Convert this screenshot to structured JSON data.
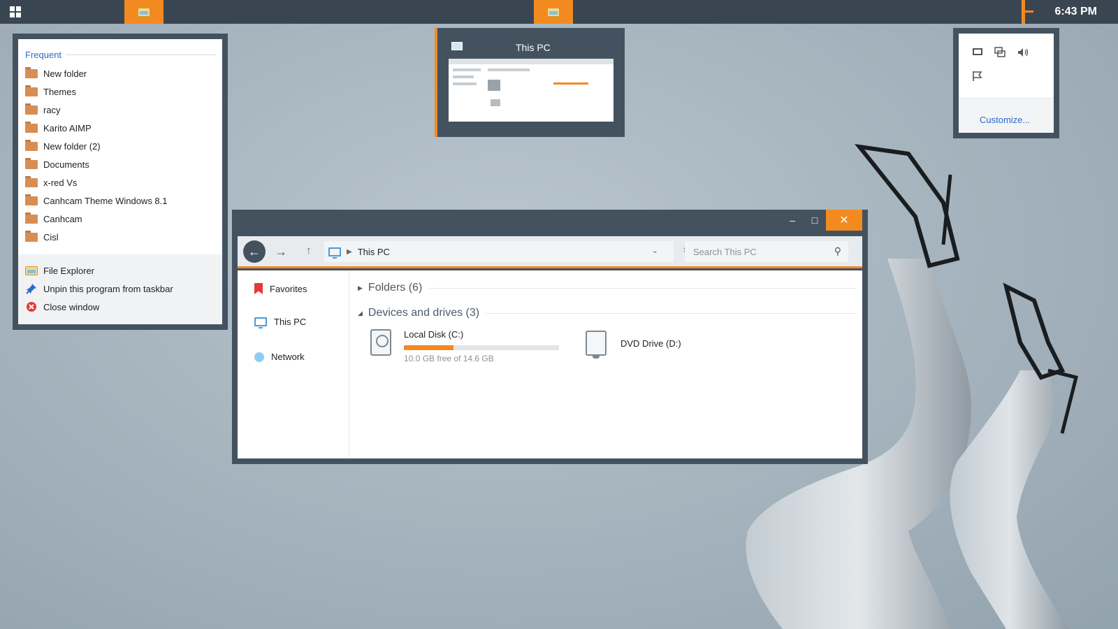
{
  "taskbar": {
    "clock": "6:43 PM",
    "apps": [
      {
        "name": "File Explorer"
      },
      {
        "name": "File Explorer"
      }
    ]
  },
  "jumplist": {
    "header": "Frequent",
    "items": [
      {
        "label": "New folder"
      },
      {
        "label": "Themes"
      },
      {
        "label": "racy"
      },
      {
        "label": "Karito AIMP"
      },
      {
        "label": "New folder (2)"
      },
      {
        "label": "Documents"
      },
      {
        "label": "x-red Vs"
      },
      {
        "label": "Canhcam Theme Windows 8.1"
      },
      {
        "label": "Canhcam"
      },
      {
        "label": "Cisl"
      }
    ],
    "tasks": {
      "file_explorer": "File Explorer",
      "unpin": "Unpin this program from taskbar",
      "close": "Close window"
    }
  },
  "thumbnail": {
    "title": "This PC"
  },
  "tray": {
    "icons": [
      "network-icon",
      "display-icon",
      "volume-icon",
      "flag-icon"
    ],
    "customize": "Customize..."
  },
  "explorer": {
    "controls": {
      "minimize": "–",
      "maximize": "□",
      "close": "✕"
    },
    "address": {
      "location": "This PC"
    },
    "search": {
      "placeholder": "Search This PC"
    },
    "nav": {
      "favorites": "Favorites",
      "this_pc": "This PC",
      "network": "Network"
    },
    "groups": {
      "folders": "Folders (6)",
      "devices": "Devices and drives (3)"
    },
    "drives": {
      "c": {
        "name": "Local Disk (C:)",
        "free": "10.0 GB free of 14.6 GB",
        "used_fraction": 0.32
      },
      "d": {
        "name": "DVD Drive (D:)"
      }
    }
  },
  "colors": {
    "accent": "#f28a1f",
    "chrome": "#445260",
    "taskbar": "#394652",
    "link": "#2c6cc7"
  }
}
